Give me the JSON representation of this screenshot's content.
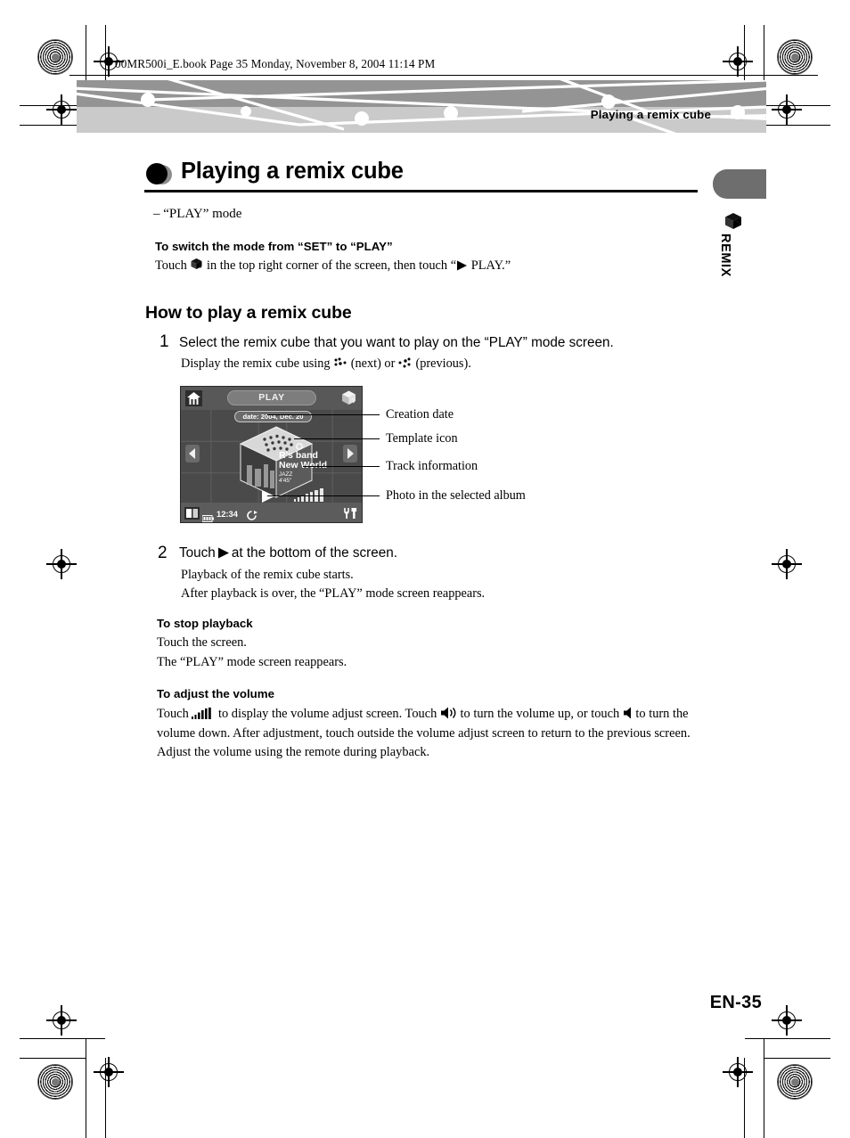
{
  "print": {
    "file_line": "00MR500i_E.book  Page 35  Monday, November 8, 2004  11:14 PM"
  },
  "running_header": {
    "title": "Playing a remix cube"
  },
  "chapter": {
    "title": "Playing a remix cube",
    "mode_line": "– “PLAY” mode"
  },
  "side_tab": {
    "label": "REMIX",
    "icon": "cube-icon"
  },
  "switch_mode": {
    "heading": "To switch the mode from “SET” to “PLAY”",
    "text_before": "Touch",
    "text_middle": "in the top right corner of the screen, then touch “",
    "text_after": "PLAY.”"
  },
  "how_to": {
    "heading": "How to play a remix cube",
    "steps": [
      {
        "number": "1",
        "text": "Select the remix cube that you want to play on the “PLAY” mode screen.",
        "sub_before": "Display the remix cube using",
        "sub_next": "(next) or",
        "sub_prev": "(previous)."
      },
      {
        "number": "2",
        "text_before": "Touch",
        "text_after": "at the bottom of the screen.",
        "sub1": "Playback of the remix cube starts.",
        "sub2": "After playback is over, the “PLAY” mode screen reappears."
      }
    ]
  },
  "device_screen": {
    "mode_label": "PLAY",
    "date_badge": "date: 2004, Dec. 20",
    "track": {
      "artist": "R's band",
      "title": "New World",
      "genre": "JAZZ",
      "duration": "4'45\""
    },
    "clock": "12:34",
    "icons": {
      "home": "home-icon",
      "cube": "cube-icon",
      "prev": "prev-arrow-icon",
      "next": "next-arrow-icon",
      "play": "play-icon",
      "photo": "photo-icon",
      "battery": "battery-icon",
      "repeat": "repeat-icon",
      "volume": "volume-bars-icon",
      "tools": "tools-icon"
    }
  },
  "callouts": [
    "Creation date",
    "Template icon",
    "Track information",
    "Photo in the selected album"
  ],
  "stop_playback": {
    "heading": "To stop playback",
    "line1": "Touch the screen.",
    "line2": "The “PLAY” mode screen reappears."
  },
  "adjust_volume": {
    "heading": "To adjust the volume",
    "seg1": "Touch",
    "seg2": "to display the volume adjust screen. Touch",
    "seg3": "to turn the volume up, or touch",
    "seg4": "to turn the",
    "seg5": "volume down. After adjustment, touch outside the volume adjust screen to return to the previous screen.",
    "seg6": "Adjust the volume using the remote during playback."
  },
  "page_number": "EN-35",
  "colors": {
    "band_top": "#949494",
    "band_bottom": "#cacaca",
    "tab_gray": "#6e6e6e",
    "screen_bg": "#4a4a4a"
  }
}
